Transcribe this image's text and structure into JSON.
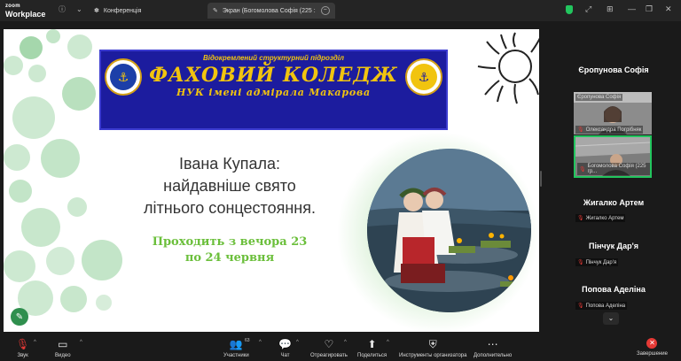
{
  "titlebar": {
    "logo_line1": "zoom",
    "logo_line2": "Workplace",
    "tab_conference": "Конференція",
    "tab_screen": "Экран (Богомолова Софія (225 :"
  },
  "slide": {
    "banner_top": "Відокремлений структурний підрозділ",
    "banner_main": "ФАХОВИЙ КОЛЕДЖ",
    "banner_sub": "НУК імені адмірала Макарова",
    "title_line1": "Івана Купала:",
    "title_line2": "найдавніше свято",
    "title_line3": "літнього сонцестояння.",
    "green_line1": "Проходить з вечора 23",
    "green_line2": "по 24 червня"
  },
  "participants": [
    {
      "name": "Єропунова Софія",
      "small_label": "Єропунова Софія",
      "video_name": "Олександра Погрібняк"
    },
    {
      "video_name": "Богомолова Софія (225 гр..."
    },
    {
      "name": "Жигалко Артем",
      "small_label": "Жигалко Артем"
    },
    {
      "name": "Пінчук Дар'я",
      "small_label": "Пінчук Дар'я"
    },
    {
      "name": "Попова Аделіна",
      "small_label": "Попова Аделіна"
    }
  ],
  "toolbar": {
    "audio": "Звук",
    "video": "Видео",
    "participants": "Участники",
    "participants_count": "63",
    "chat": "Чат",
    "react": "Отреагировать",
    "share": "Поделиться",
    "host_tools": "Инструменты организатора",
    "more": "Дополнительно",
    "end": "Завершение"
  },
  "colors": {
    "accent_green": "#22c55e",
    "end_red": "#e53935",
    "banner_blue": "#1c1c9e",
    "banner_gold": "#f1c40f",
    "slide_green_text": "#6bbf3b"
  }
}
